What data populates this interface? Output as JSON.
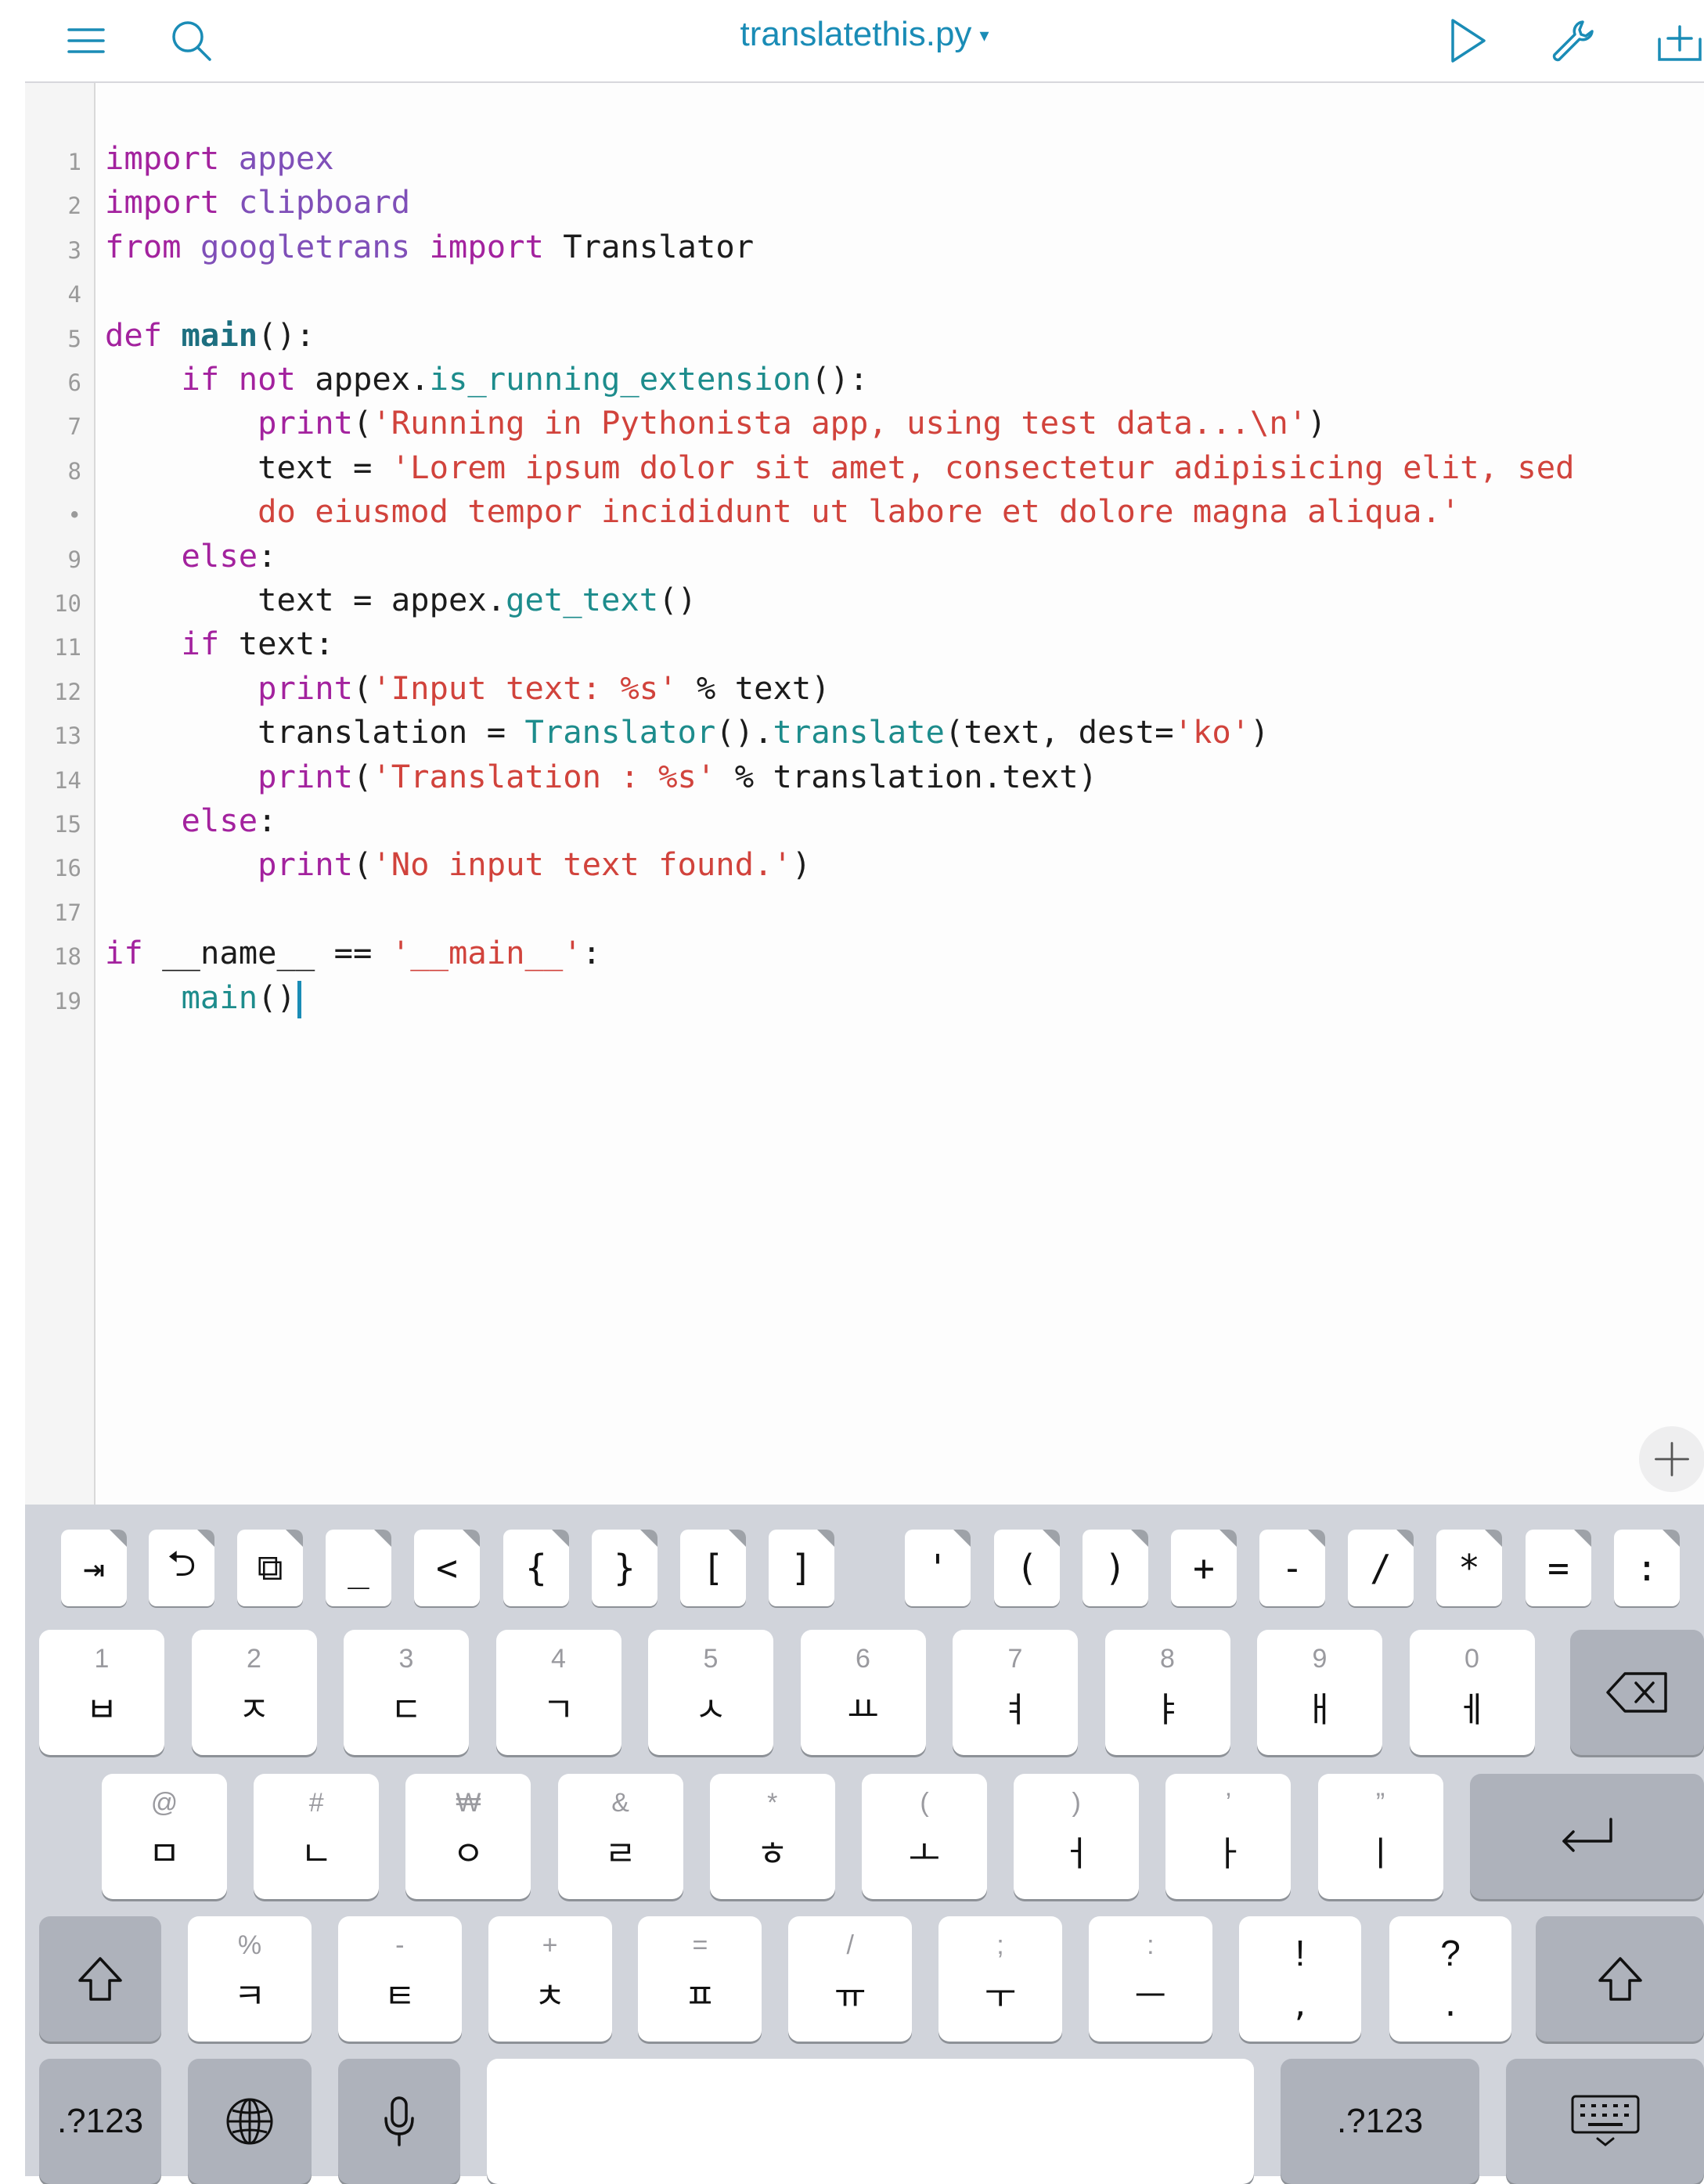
{
  "toolbar": {
    "title": "translatethis.py",
    "title_caret": "▾",
    "icons": [
      "menu-icon",
      "search-icon",
      "run-icon",
      "wrench-icon",
      "add-tab-icon"
    ]
  },
  "editor": {
    "line_numbers": [
      "1",
      "2",
      "3",
      "4",
      "5",
      "6",
      "7",
      "8",
      "•",
      "9",
      "10",
      "11",
      "12",
      "13",
      "14",
      "15",
      "16",
      "17",
      "18",
      "19"
    ],
    "code_lines": [
      "import appex",
      "import clipboard",
      "from googletrans import Translator",
      "",
      "def main():",
      "    if not appex.is_running_extension():",
      "        print('Running in Pythonista app, using test data...\\n')",
      "        text = 'Lorem ipsum dolor sit amet, consectetur adipisicing elit, sed",
      "        do eiusmod tempor incididunt ut labore et dolore magna aliqua.'",
      "    else:",
      "        text = appex.get_text()",
      "    if text:",
      "        print('Input text: %s' % text)",
      "        translation = Translator().translate(text, dest='ko')",
      "        print('Translation : %s' % translation.text)",
      "    else:",
      "        print('No input text found.')",
      "",
      "if __name__ == '__main__':",
      "    main()"
    ],
    "plus_button": "+"
  },
  "colors": {
    "accent": "#1a8cb6",
    "keyword": "#a3229e",
    "module": "#7f4fb8",
    "function": "#1d8c8c",
    "string": "#d1433c",
    "keyboard_bg": "#d1d4db"
  },
  "keyboard": {
    "accessory_keys": [
      "⇥",
      "⮌",
      "⧉",
      "_",
      "<",
      "{",
      "}",
      "[",
      "]",
      "'",
      "(",
      ")",
      "+",
      "-",
      "/",
      "*",
      "=",
      ":"
    ],
    "row1": [
      {
        "hint": "1",
        "main": "ㅂ"
      },
      {
        "hint": "2",
        "main": "ㅈ"
      },
      {
        "hint": "3",
        "main": "ㄷ"
      },
      {
        "hint": "4",
        "main": "ㄱ"
      },
      {
        "hint": "5",
        "main": "ㅅ"
      },
      {
        "hint": "6",
        "main": "ㅛ"
      },
      {
        "hint": "7",
        "main": "ㅕ"
      },
      {
        "hint": "8",
        "main": "ㅑ"
      },
      {
        "hint": "9",
        "main": "ㅐ"
      },
      {
        "hint": "0",
        "main": "ㅔ"
      }
    ],
    "row2": [
      {
        "hint": "@",
        "main": "ㅁ"
      },
      {
        "hint": "#",
        "main": "ㄴ"
      },
      {
        "hint": "₩",
        "main": "ㅇ"
      },
      {
        "hint": "&",
        "main": "ㄹ"
      },
      {
        "hint": "*",
        "main": "ㅎ"
      },
      {
        "hint": "(",
        "main": "ㅗ"
      },
      {
        "hint": ")",
        "main": "ㅓ"
      },
      {
        "hint": "’",
        "main": "ㅏ"
      },
      {
        "hint": "”",
        "main": "ㅣ"
      }
    ],
    "row3": [
      {
        "hint": "%",
        "main": "ㅋ"
      },
      {
        "hint": "-",
        "main": "ㅌ"
      },
      {
        "hint": "+",
        "main": "ㅊ"
      },
      {
        "hint": "=",
        "main": "ㅍ"
      },
      {
        "hint": "/",
        "main": "ㅠ"
      },
      {
        "hint": ";",
        "main": "ㅜ"
      },
      {
        "hint": ":",
        "main": "ㅡ"
      }
    ],
    "row3_punct": [
      {
        "hint": "!",
        "main": ","
      },
      {
        "hint": "?",
        "main": "."
      }
    ],
    "numbers_label": ".?123",
    "space_label": ""
  }
}
